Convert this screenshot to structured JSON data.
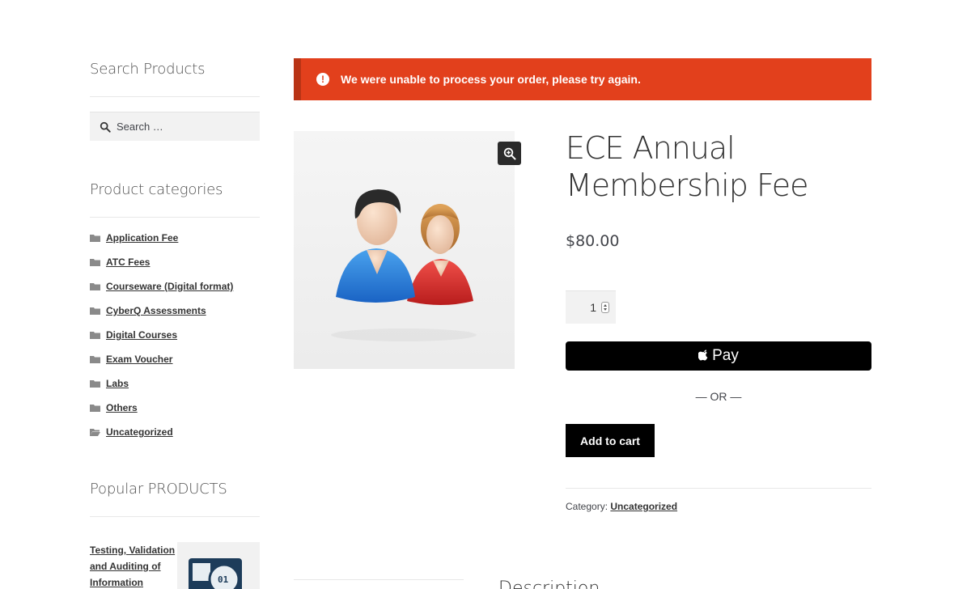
{
  "sidebar": {
    "search": {
      "title": "Search Products",
      "placeholder": "Search …"
    },
    "categories": {
      "title": "Product categories",
      "items": [
        {
          "label": "Application Fee"
        },
        {
          "label": "ATC Fees"
        },
        {
          "label": "Courseware (Digital format)"
        },
        {
          "label": "CyberQ Assessments"
        },
        {
          "label": "Digital Courses"
        },
        {
          "label": "Exam Voucher"
        },
        {
          "label": "Labs"
        },
        {
          "label": "Others"
        },
        {
          "label": "Uncategorized"
        }
      ]
    },
    "popular": {
      "title": "Popular PRODUCTS",
      "item_label": "Testing, Validation and Auditing of Information Systems"
    }
  },
  "notice": {
    "message": "We were unable to process your order, please try again.",
    "icon": "exclamation-circle-icon",
    "color": "#e2401c"
  },
  "product": {
    "title": "ECE Annual Membership Fee",
    "price": "$80.00",
    "quantity": "1",
    "applepay_label": "Pay",
    "or_text": "— OR —",
    "add_to_cart_label": "Add to cart",
    "category_label": "Category:",
    "category_value": "Uncategorized",
    "image_icon": "users-icon"
  },
  "tabs": {
    "description_label": "Description"
  },
  "colors": {
    "accent": "#e2401c",
    "button": "#000000"
  }
}
